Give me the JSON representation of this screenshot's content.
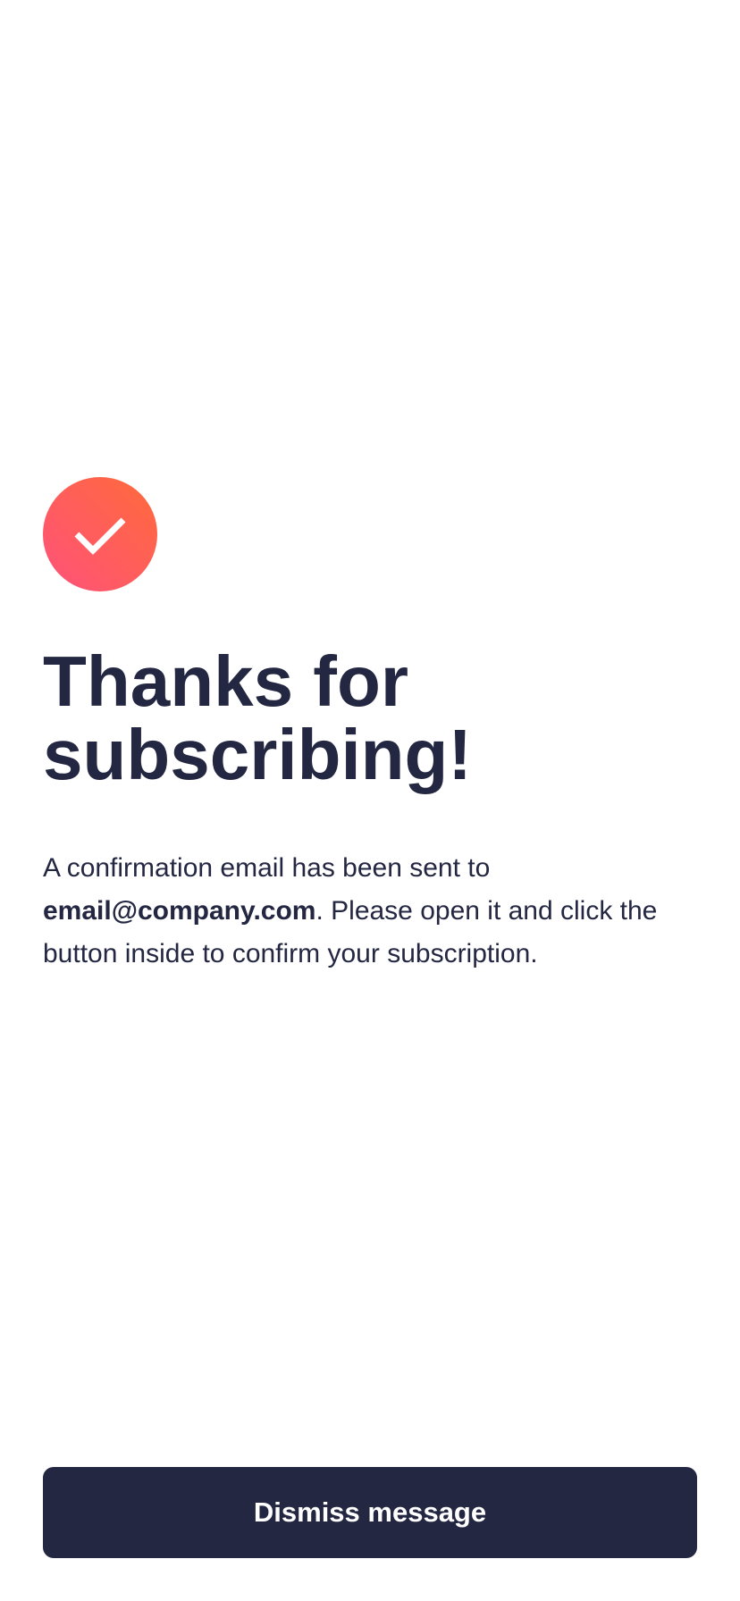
{
  "success": {
    "icon": "checkmark-icon",
    "gradient_start": "#ff6a3a",
    "gradient_end": "#ff527b"
  },
  "title": {
    "line1": "Thanks for",
    "line2": "subscribing!"
  },
  "message": {
    "prefix": "A confirmation email has been sent to",
    "email": "email@company.com",
    "suffix": ". Please open it and click the button inside to confirm your subscription."
  },
  "dismiss_button": {
    "label": "Dismiss message",
    "color": "#242742"
  }
}
